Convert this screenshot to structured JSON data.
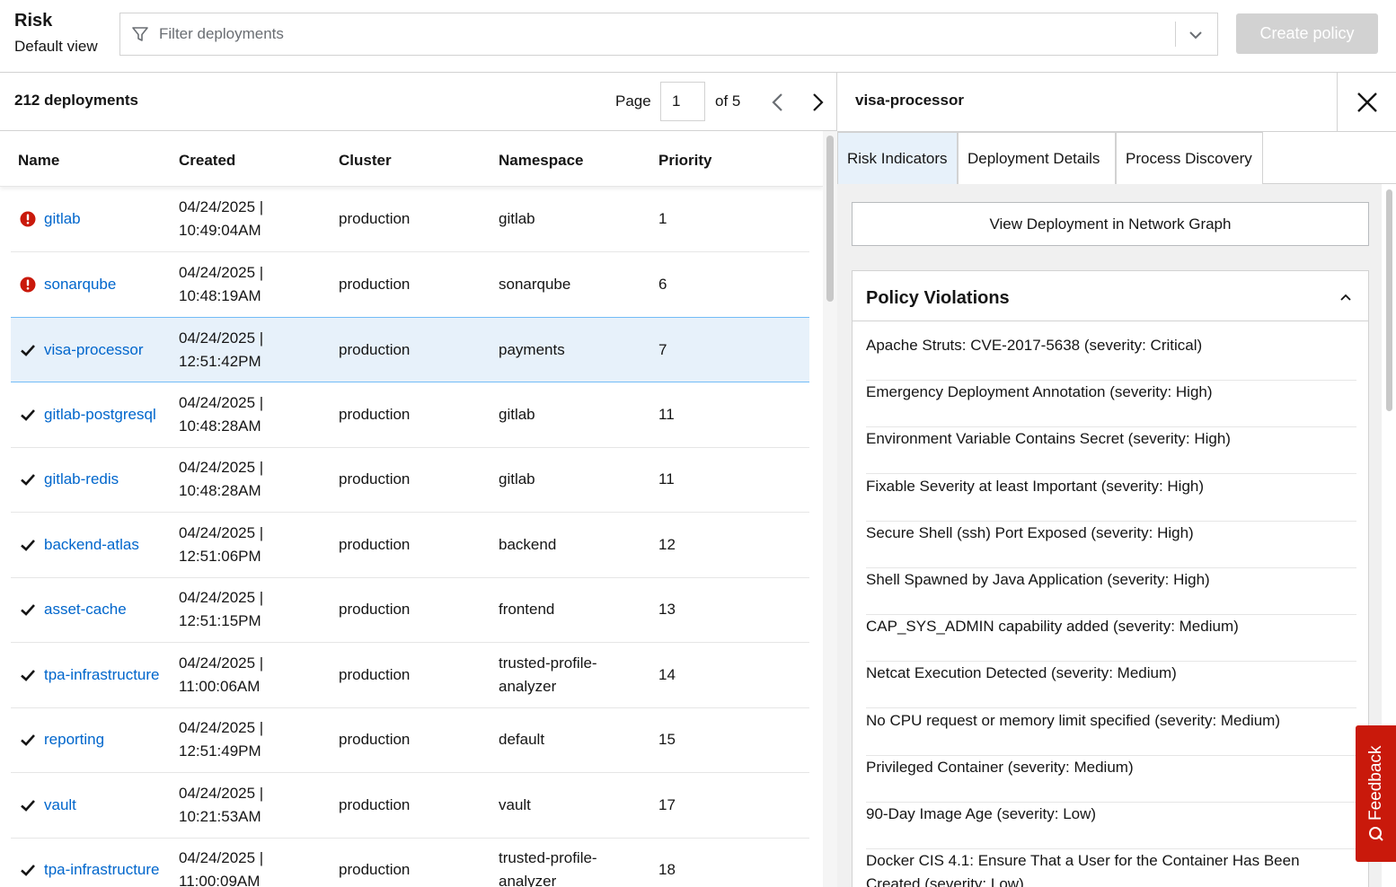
{
  "header": {
    "title": "Risk",
    "subtitle": "Default view",
    "filter_placeholder": "Filter deployments",
    "create_policy_label": "Create policy"
  },
  "list": {
    "count_label": "212 deployments",
    "page_label": "Page",
    "page_value": "1",
    "of_label": "of 5",
    "columns": [
      "Name",
      "Created",
      "Cluster",
      "Namespace",
      "Priority"
    ],
    "rows": [
      {
        "status": "alert",
        "name": "gitlab",
        "created_date": "04/24/2025 |",
        "created_time": "10:49:04AM",
        "cluster": "production",
        "namespace": "gitlab",
        "priority": "1"
      },
      {
        "status": "alert",
        "name": "sonarqube",
        "created_date": "04/24/2025 |",
        "created_time": "10:48:19AM",
        "cluster": "production",
        "namespace": "sonarqube",
        "priority": "6"
      },
      {
        "status": "ok",
        "name": "visa-processor",
        "created_date": "04/24/2025 |",
        "created_time": "12:51:42PM",
        "cluster": "production",
        "namespace": "payments",
        "priority": "7"
      },
      {
        "status": "ok",
        "name": "gitlab-postgresql",
        "created_date": "04/24/2025 |",
        "created_time": "10:48:28AM",
        "cluster": "production",
        "namespace": "gitlab",
        "priority": "11"
      },
      {
        "status": "ok",
        "name": "gitlab-redis",
        "created_date": "04/24/2025 |",
        "created_time": "10:48:28AM",
        "cluster": "production",
        "namespace": "gitlab",
        "priority": "11"
      },
      {
        "status": "ok",
        "name": "backend-atlas",
        "created_date": "04/24/2025 |",
        "created_time": "12:51:06PM",
        "cluster": "production",
        "namespace": "backend",
        "priority": "12"
      },
      {
        "status": "ok",
        "name": "asset-cache",
        "created_date": "04/24/2025 |",
        "created_time": "12:51:15PM",
        "cluster": "production",
        "namespace": "frontend",
        "priority": "13"
      },
      {
        "status": "ok",
        "name": "tpa-infrastructure",
        "created_date": "04/24/2025 |",
        "created_time": "11:00:06AM",
        "cluster": "production",
        "namespace": "trusted-profile-analyzer",
        "priority": "14"
      },
      {
        "status": "ok",
        "name": "reporting",
        "created_date": "04/24/2025 |",
        "created_time": "12:51:49PM",
        "cluster": "production",
        "namespace": "default",
        "priority": "15"
      },
      {
        "status": "ok",
        "name": "vault",
        "created_date": "04/24/2025 |",
        "created_time": "10:21:53AM",
        "cluster": "production",
        "namespace": "vault",
        "priority": "17"
      },
      {
        "status": "ok",
        "name": "tpa-infrastructure",
        "created_date": "04/24/2025 |",
        "created_time": "11:00:09AM",
        "cluster": "production",
        "namespace": "trusted-profile-analyzer",
        "priority": "18"
      }
    ]
  },
  "drawer": {
    "title": "visa-processor",
    "tabs": [
      "Risk Indicators",
      "Deployment Details",
      "Process Discovery"
    ],
    "view_graph_label": "View Deployment in Network Graph",
    "violations_title": "Policy Violations",
    "violations": [
      "Apache Struts: CVE-2017-5638 (severity: Critical)",
      "Emergency Deployment Annotation (severity: High)",
      "Environment Variable Contains Secret (severity: High)",
      "Fixable Severity at least Important (severity: High)",
      "Secure Shell (ssh) Port Exposed (severity: High)",
      "Shell Spawned by Java Application (severity: High)",
      "CAP_SYS_ADMIN capability added (severity: Medium)",
      "Netcat Execution Detected (severity: Medium)",
      "No CPU request or memory limit specified (severity: Medium)",
      "Privileged Container (severity: Medium)",
      "90-Day Image Age (severity: Low)",
      "Docker CIS 4.1: Ensure That a User for the Container Has Been Created (severity: Low)"
    ]
  },
  "feedback_label": "Feedback",
  "colors": {
    "link": "#0066cc",
    "alert": "#c9190b",
    "selected_row": "#e7f1fa",
    "feedback": "#c9190b"
  }
}
